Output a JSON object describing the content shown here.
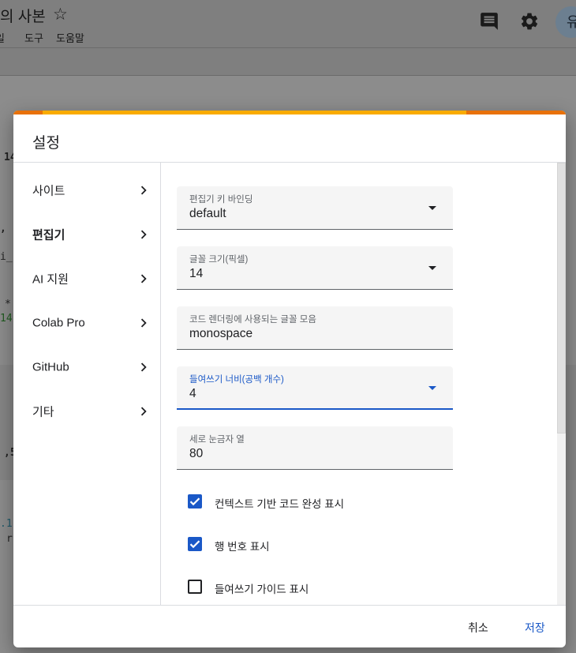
{
  "app": {
    "doc_title": "의 사본",
    "menu": [
      "파일",
      "도구",
      "도움말"
    ],
    "menu_visible": [
      "일",
      "도구",
      "도움말"
    ],
    "avatar_letter": "유"
  },
  "background_fragments": {
    "f1": "14",
    "f2": ",",
    "f3": "i_",
    "f4": "*",
    "f5": "14",
    "f6": ",5",
    "f7": ".1",
    "f8": "r"
  },
  "dialog": {
    "title": "설정",
    "nav": [
      {
        "label": "사이트"
      },
      {
        "label": "편집기"
      },
      {
        "label": "AI 지원"
      },
      {
        "label": "Colab Pro"
      },
      {
        "label": "GitHub"
      },
      {
        "label": "기타"
      }
    ],
    "active_nav": "편집기",
    "fields": [
      {
        "label": "편집기 키 바인딩",
        "value": "default"
      },
      {
        "label": "글꼴 크기(픽셀)",
        "value": "14"
      },
      {
        "label": "코드 렌더링에 사용되는 글꼴 모음",
        "value": "monospace"
      },
      {
        "label": "들여쓰기 너비(공백 개수)",
        "value": "4"
      },
      {
        "label": "세로 눈금자 열",
        "value": "80"
      }
    ],
    "checkboxes": [
      {
        "label": "컨텍스트 기반 코드 완성 표시",
        "checked": true
      },
      {
        "label": "행 번호 표시",
        "checked": true
      },
      {
        "label": "들여쓰기 가이드 표시",
        "checked": false
      }
    ],
    "buttons": {
      "cancel": "취소",
      "save": "저장"
    }
  },
  "colors": {
    "accent": "#f9ab00",
    "accent_dark": "#e8710a",
    "primary": "#1a58c7"
  }
}
